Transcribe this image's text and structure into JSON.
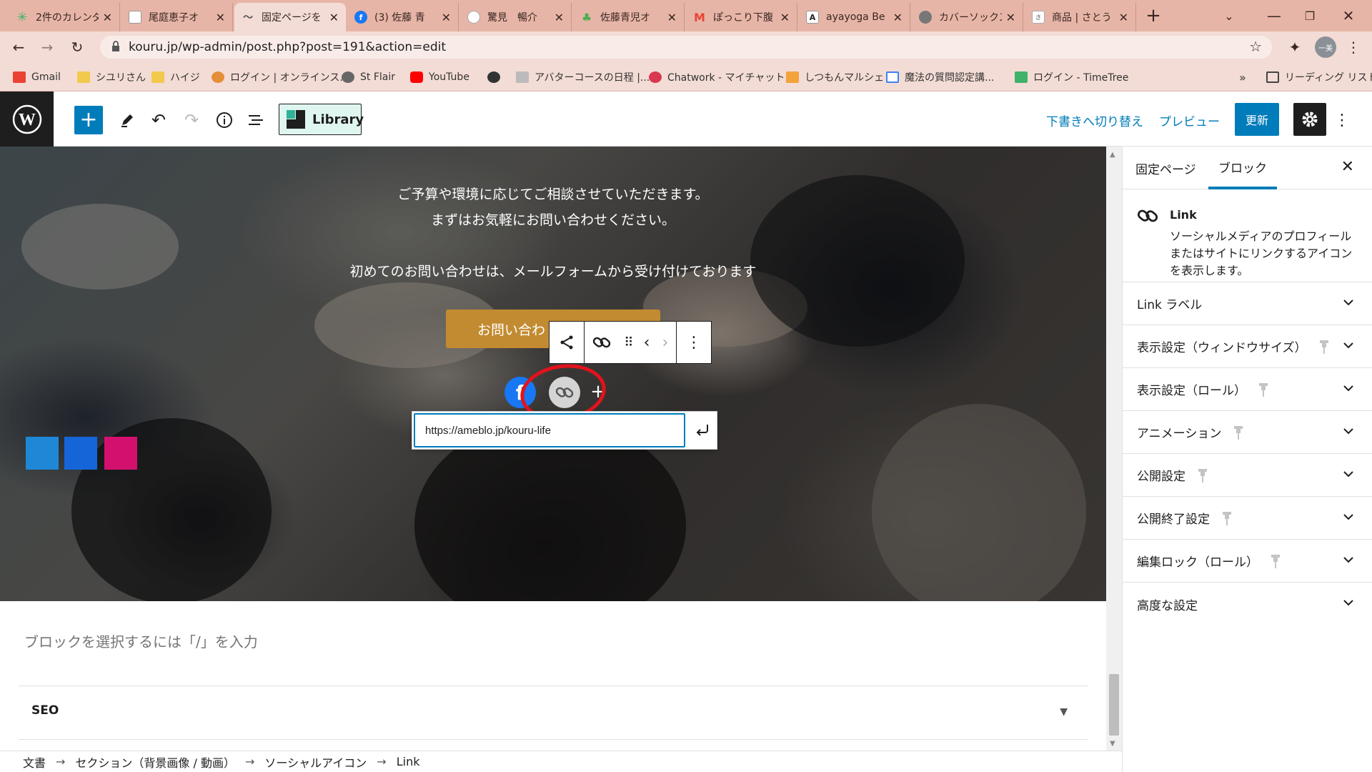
{
  "browser": {
    "tabs": [
      {
        "title": "2件のカレンダ",
        "favicon_color": "#3fb36a"
      },
      {
        "title": "尾庭恵子オ",
        "favicon_color": "#ffffff"
      },
      {
        "title": "固定ページを",
        "favicon_color": "#555555",
        "active": true
      },
      {
        "title": "(3) 佐藤 青",
        "favicon_color": "#1877f2"
      },
      {
        "title": "驚見　暢介",
        "favicon_color": "#ffffff"
      },
      {
        "title": "佐藤青児オ",
        "favicon_color": "#4caf50"
      },
      {
        "title": "ぽっこり下腹",
        "favicon_color": "#ea4335"
      },
      {
        "title": "ayayoga Be",
        "favicon_color": "#ffffff"
      },
      {
        "title": "カバーソックス",
        "favicon_color": "#555555"
      },
      {
        "title": "商品 | さとう",
        "favicon_color": "#999999"
      }
    ],
    "new_tab": "+",
    "url": "kouru.jp/wp-admin/post.php?post=191&action=edit",
    "profile_initial": "一美",
    "bookmarks": [
      {
        "label": "Gmail",
        "color": "#ea4335"
      },
      {
        "label": "シユリさん",
        "color": "#f2c94c"
      },
      {
        "label": "ハイジ",
        "color": "#f2c94c"
      },
      {
        "label": "ログイン | オンラインス...",
        "color": "#e58e3a"
      },
      {
        "label": "St Flair",
        "color": "#666666"
      },
      {
        "label": "YouTube",
        "color": "#ff0000"
      },
      {
        "label": "",
        "color": "#333333"
      },
      {
        "label": "アバターコースの日程 |...",
        "color": "#888888"
      },
      {
        "label": "Chatwork - マイチャット",
        "color": "#d8394e"
      },
      {
        "label": "しつもんマルシェ",
        "color": "#f2a33a"
      },
      {
        "label": "魔法の質問認定講...",
        "color": "#3b82f6"
      },
      {
        "label": "ログイン - TimeTree",
        "color": "#3fb36a"
      }
    ],
    "bookmarks_overflow": "»",
    "reading_list": "リーディング リスト"
  },
  "editor": {
    "library_label": "Library",
    "switch_to_draft": "下書きへ切り替え",
    "preview": "プレビュー",
    "update": "更新"
  },
  "hero": {
    "line1": "ご予算や環境に応じてご相談させていただきます。",
    "line2": "まずはお気軽にお問い合わせください。",
    "line3": "初めてのお問い合わせは、メールフォームから受け付けております",
    "cta_partial": "お問い合わ",
    "squares": [
      "#1e88d6",
      "#1565d8",
      "#d4106e"
    ]
  },
  "social": {
    "facebook_glyph": "f",
    "add_glyph": "+",
    "url_value": "https://ameblo.jp/kouru-life"
  },
  "canvas": {
    "appender": "ブロックを選択するには「/」を入力",
    "seo_label": "SEO"
  },
  "breadcrumbs": [
    "文書",
    "セクション（背景画像 / 動画）",
    "ソーシャルアイコン",
    "Link"
  ],
  "breadcrumb_sep": "→",
  "sidebar": {
    "tab_page": "固定ページ",
    "tab_block": "ブロック",
    "block_name": "Link",
    "block_description": "ソーシャルメディアのプロフィールまたはサイトにリンクするアイコンを表示します。",
    "panels": [
      {
        "label": "Link ラベル",
        "pin": false
      },
      {
        "label": "表示設定（ウィンドウサイズ）",
        "pin": true
      },
      {
        "label": "表示設定（ロール）",
        "pin": true
      },
      {
        "label": "アニメーション",
        "pin": true
      },
      {
        "label": "公開設定",
        "pin": true
      },
      {
        "label": "公開終了設定",
        "pin": true
      },
      {
        "label": "編集ロック（ロール）",
        "pin": true
      },
      {
        "label": "高度な設定",
        "pin": false
      }
    ]
  }
}
